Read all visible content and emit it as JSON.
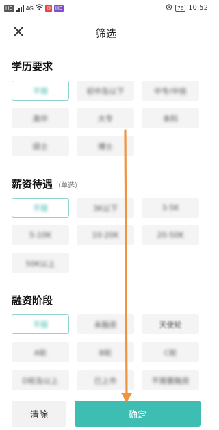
{
  "status_bar": {
    "left_badges": [
      "HD",
      "4G",
      "HD"
    ],
    "battery": "76",
    "time": "10:52"
  },
  "nav": {
    "title": "筛选",
    "close_icon": "close-icon"
  },
  "sections": [
    {
      "title": "学历要求",
      "subtitle": "",
      "options": [
        "不限",
        "初中及以下",
        "中专/中技",
        "高中",
        "大专",
        "本科",
        "硕士",
        "博士"
      ],
      "selected": 0
    },
    {
      "title": "薪资待遇",
      "subtitle": "（单选）",
      "options": [
        "不限",
        "3K以下",
        "3-5K",
        "5-10K",
        "10-20K",
        "20-50K",
        "50K以上"
      ],
      "selected": 0
    },
    {
      "title": "融资阶段",
      "subtitle": "",
      "options": [
        "不限",
        "未融资",
        "天使轮",
        "A轮",
        "B轮",
        "C轮",
        "D轮及以上",
        "已上市",
        "不需要融资"
      ],
      "selected": 0
    }
  ],
  "bottom": {
    "clear_label": "清除",
    "confirm_label": "确定"
  },
  "colors": {
    "accent": "#3ebdb2",
    "arrow": "#f0943f"
  }
}
